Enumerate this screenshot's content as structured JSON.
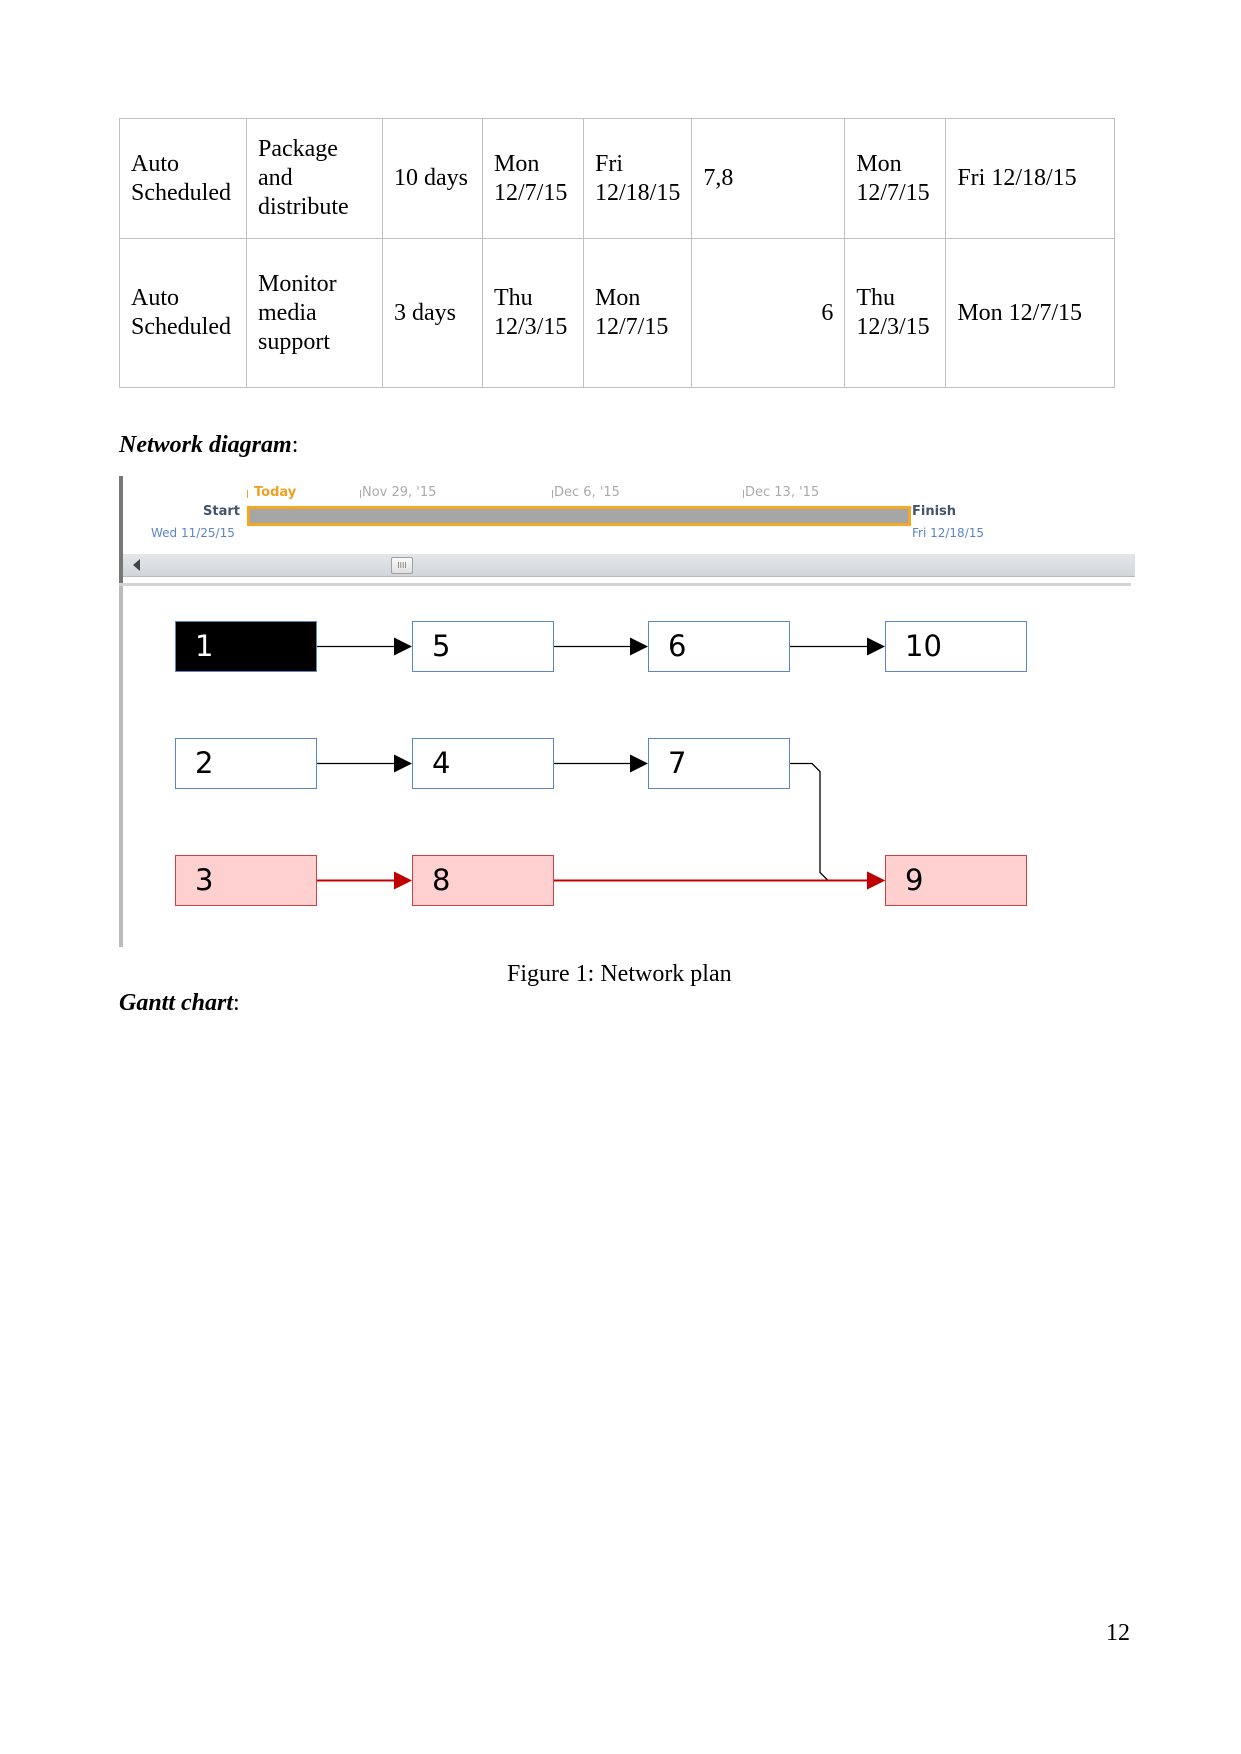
{
  "table": {
    "rows": [
      {
        "mode": "Auto Scheduled",
        "name": "Package and distribute",
        "duration": "10 days",
        "start": "Mon 12/7/15",
        "finish": "Fri 12/18/15",
        "predecessors": "7,8",
        "baseline_start": "Mon 12/7/15",
        "baseline_finish": "Fri 12/18/15"
      },
      {
        "mode": "Auto Scheduled",
        "name": "Monitor media support",
        "duration": "3 days",
        "start": "Thu 12/3/15",
        "finish": "Mon 12/7/15",
        "predecessors": "6",
        "baseline_start": "Thu 12/3/15",
        "baseline_finish": "Mon 12/7/15"
      }
    ]
  },
  "network_heading": {
    "text": "Network diagram",
    "colon": ":"
  },
  "timeline": {
    "today_label": "Today",
    "ticks": [
      "Nov 29, '15",
      "Dec 6, '15",
      "Dec 13, '15"
    ],
    "start_label": "Start",
    "start_date": "Wed 11/25/15",
    "finish_label": "Finish",
    "finish_date": "Fri 12/18/15",
    "scroll_thumb": "IIII",
    "bar_color": "#a6a6a6",
    "bar_border_color": "#f5a623"
  },
  "network": {
    "nodes": [
      {
        "id": "1",
        "style": "selected"
      },
      {
        "id": "5",
        "style": "normal"
      },
      {
        "id": "6",
        "style": "normal"
      },
      {
        "id": "10",
        "style": "normal"
      },
      {
        "id": "2",
        "style": "normal"
      },
      {
        "id": "4",
        "style": "normal"
      },
      {
        "id": "7",
        "style": "normal"
      },
      {
        "id": "3",
        "style": "critical"
      },
      {
        "id": "8",
        "style": "critical"
      },
      {
        "id": "9",
        "style": "critical"
      }
    ],
    "links": [
      {
        "from": "1",
        "to": "5",
        "critical": false
      },
      {
        "from": "5",
        "to": "6",
        "critical": false
      },
      {
        "from": "6",
        "to": "10",
        "critical": false
      },
      {
        "from": "2",
        "to": "4",
        "critical": false
      },
      {
        "from": "4",
        "to": "7",
        "critical": false
      },
      {
        "from": "7",
        "to": "9",
        "critical": false
      },
      {
        "from": "3",
        "to": "8",
        "critical": true
      },
      {
        "from": "8",
        "to": "9",
        "critical": true
      }
    ],
    "colors": {
      "normal_border": "#5b86c6",
      "critical_fill": "#ffd0d0",
      "critical_line": "#c00000"
    }
  },
  "caption": "Figure 1: Network plan",
  "gantt_heading": {
    "text": "Gantt chart",
    "colon": ":"
  },
  "page_number": "12"
}
